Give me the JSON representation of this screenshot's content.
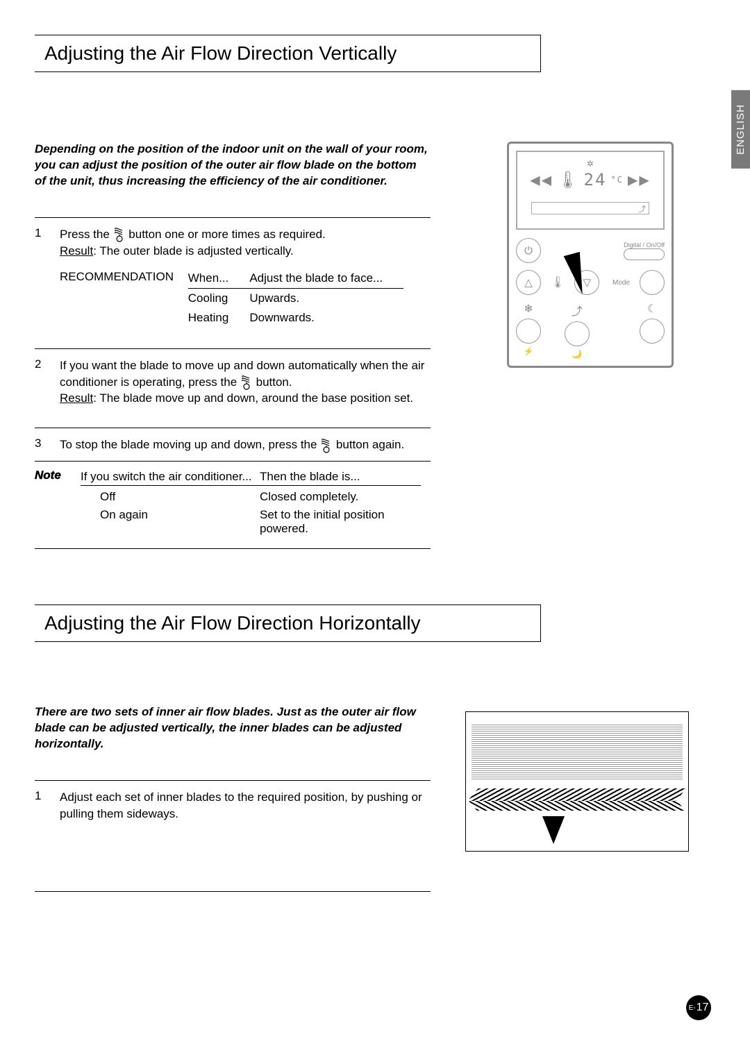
{
  "language_tab": "ENGLISH",
  "section1": {
    "title": "Adjusting the Air Flow Direction Vertically",
    "intro": "Depending on the position of the indoor unit on the wall of your room, you can adjust the position of the outer air flow blade on the bottom of the unit, thus increasing the efficiency of the air conditioner.",
    "step1": {
      "num": "1",
      "text_a": "Press the ",
      "text_b": " button one or more times as required.",
      "result_label": "Result",
      "result_text": ":   The outer blade is adjusted vertically."
    },
    "rec": {
      "label": "RECOMMENDATION",
      "h1": "When...",
      "h2": "Adjust the blade to face...",
      "r1c1": "Cooling",
      "r1c2": "Upwards.",
      "r2c1": "Heating",
      "r2c2": "Downwards."
    },
    "step2": {
      "num": "2",
      "text_a": "If you want the blade to move up and down automatically when the air conditioner is operating, press the ",
      "text_b": " button.",
      "result_label": "Result",
      "result_text": ":   The blade move up and down, around the base position set."
    },
    "step3": {
      "num": "3",
      "text_a": "To stop the blade moving up and down, press the ",
      "text_b": " button again."
    },
    "note": {
      "label": "Note",
      "h1": "If you switch the air conditioner...",
      "h2": "Then the blade is...",
      "r1c1": "Off",
      "r1c2": "Closed completely.",
      "r2c1": "On again",
      "r2c2": "Set to the initial position powered."
    }
  },
  "remote": {
    "temp": "24",
    "temp_unit": "°C",
    "digital_label": "Digital / On/Off",
    "mode_label": "Mode"
  },
  "section2": {
    "title": "Adjusting the Air Flow Direction Horizontally",
    "intro": "There are two sets of inner air flow blades. Just as the outer air flow blade can be adjusted vertically, the inner blades can be adjusted horizontally.",
    "step1": {
      "num": "1",
      "text": "Adjust each set of inner blades to the required position, by pushing or pulling them sideways."
    }
  },
  "page_number_prefix": "E-",
  "page_number": "17"
}
